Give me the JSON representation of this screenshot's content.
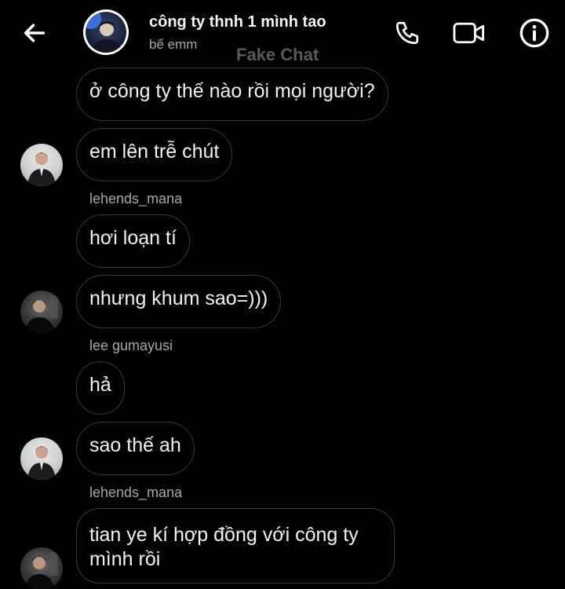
{
  "header": {
    "title": "công ty thnh 1 mình tao",
    "subtitle": "bế emm",
    "watermark": "Fake Chat"
  },
  "messages": [
    {
      "text": "ở công ty thế nào rồi mọi người?"
    },
    {
      "text": "em lên trễ chút"
    },
    {
      "sender": "lehends_mana",
      "text": "hơi loạn tí"
    },
    {
      "text": "nhưng khum sao=)))"
    },
    {
      "sender": "lee gumayusi",
      "text": "hả"
    },
    {
      "text": "sao thế ah"
    },
    {
      "sender": "lehends_mana",
      "text": "tian ye kí hợp đồng với công ty mình rồi"
    }
  ],
  "icons": {
    "back": "arrow-left-icon",
    "phone": "phone-icon",
    "video": "video-camera-icon",
    "info": "info-icon"
  },
  "colors": {
    "background": "#000000",
    "bubble_border": "#3a3a3a",
    "text": "#f2f2f2",
    "muted": "#a7a7a7"
  }
}
